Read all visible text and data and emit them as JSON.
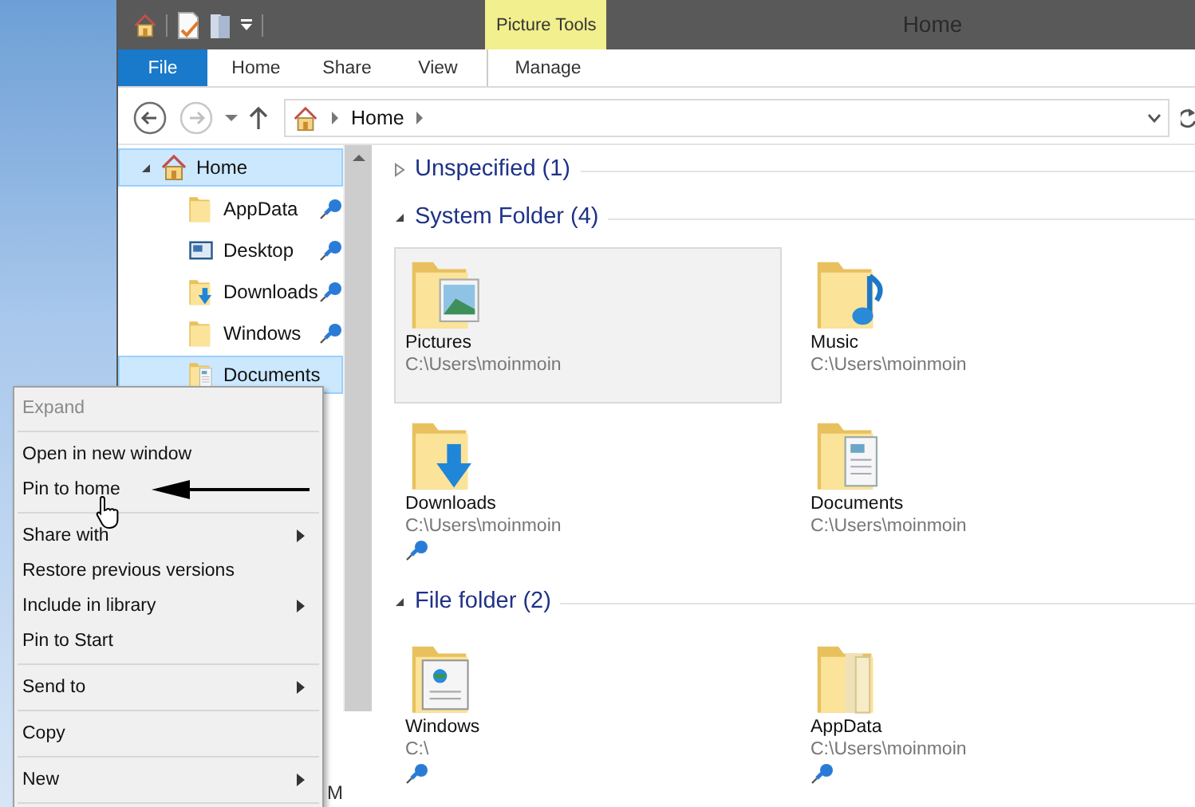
{
  "window": {
    "title": "Home"
  },
  "ribbon": {
    "contextual_label": "Picture Tools",
    "tabs": [
      {
        "label": "File",
        "kind": "file",
        "selected": false
      },
      {
        "label": "Home",
        "kind": "normal",
        "selected": false
      },
      {
        "label": "Share",
        "kind": "normal",
        "selected": false
      },
      {
        "label": "View",
        "kind": "normal",
        "selected": false
      },
      {
        "label": "Manage",
        "kind": "contextual",
        "selected": false
      }
    ]
  },
  "address_bar": {
    "path": [
      "Home"
    ]
  },
  "navigation": {
    "items": [
      {
        "label": "Home",
        "expanded": true,
        "selected": true,
        "children": [
          {
            "label": "AppData",
            "kind": "folder",
            "pinned": true,
            "selected": false
          },
          {
            "label": "Desktop",
            "kind": "desktop",
            "pinned": true,
            "selected": false
          },
          {
            "label": "Downloads",
            "kind": "downloads",
            "pinned": true,
            "selected": false
          },
          {
            "label": "Windows",
            "kind": "folder",
            "pinned": true,
            "selected": false
          },
          {
            "label": "Documents",
            "kind": "documents",
            "selected": true
          }
        ]
      }
    ],
    "cut_label": "M"
  },
  "groups": [
    {
      "title": "Unspecified (1)",
      "expanded": false
    },
    {
      "title": "System Folder (4)",
      "expanded": true,
      "items": [
        {
          "name": "Pictures",
          "path": "C:\\Users\\moinmoin",
          "kind": "pictures",
          "pinned": false,
          "selected": true
        },
        {
          "name": "Music",
          "path": "C:\\Users\\moinmoin",
          "kind": "music",
          "pinned": false,
          "selected": false
        },
        {
          "name": "Downloads",
          "path": "C:\\Users\\moinmoin",
          "kind": "downloads",
          "pinned": true,
          "selected": false
        },
        {
          "name": "Documents",
          "path": "C:\\Users\\moinmoin",
          "kind": "documents",
          "pinned": false,
          "selected": false
        }
      ]
    },
    {
      "title": "File folder (2)",
      "expanded": true,
      "items": [
        {
          "name": "Windows",
          "path": "C:\\",
          "kind": "windows",
          "pinned": true,
          "selected": false
        },
        {
          "name": "AppData",
          "path": "C:\\Users\\moinmoin",
          "kind": "plain",
          "pinned": true,
          "selected": false
        }
      ]
    }
  ],
  "context_menu": {
    "groups": [
      [
        {
          "label": "Expand",
          "disabled": true,
          "submenu": false
        }
      ],
      [
        {
          "label": "Open in new window",
          "disabled": false,
          "submenu": false
        },
        {
          "label": "Pin to home",
          "disabled": false,
          "submenu": false
        }
      ],
      [
        {
          "label": "Share with",
          "disabled": false,
          "submenu": true
        },
        {
          "label": "Restore previous versions",
          "disabled": false,
          "submenu": false
        },
        {
          "label": "Include in library",
          "disabled": false,
          "submenu": true
        },
        {
          "label": "Pin to Start",
          "disabled": false,
          "submenu": false
        }
      ],
      [
        {
          "label": "Send to",
          "disabled": false,
          "submenu": true
        }
      ],
      [
        {
          "label": "Copy",
          "disabled": false,
          "submenu": false
        }
      ],
      [
        {
          "label": "New",
          "disabled": false,
          "submenu": true
        }
      ]
    ]
  }
}
